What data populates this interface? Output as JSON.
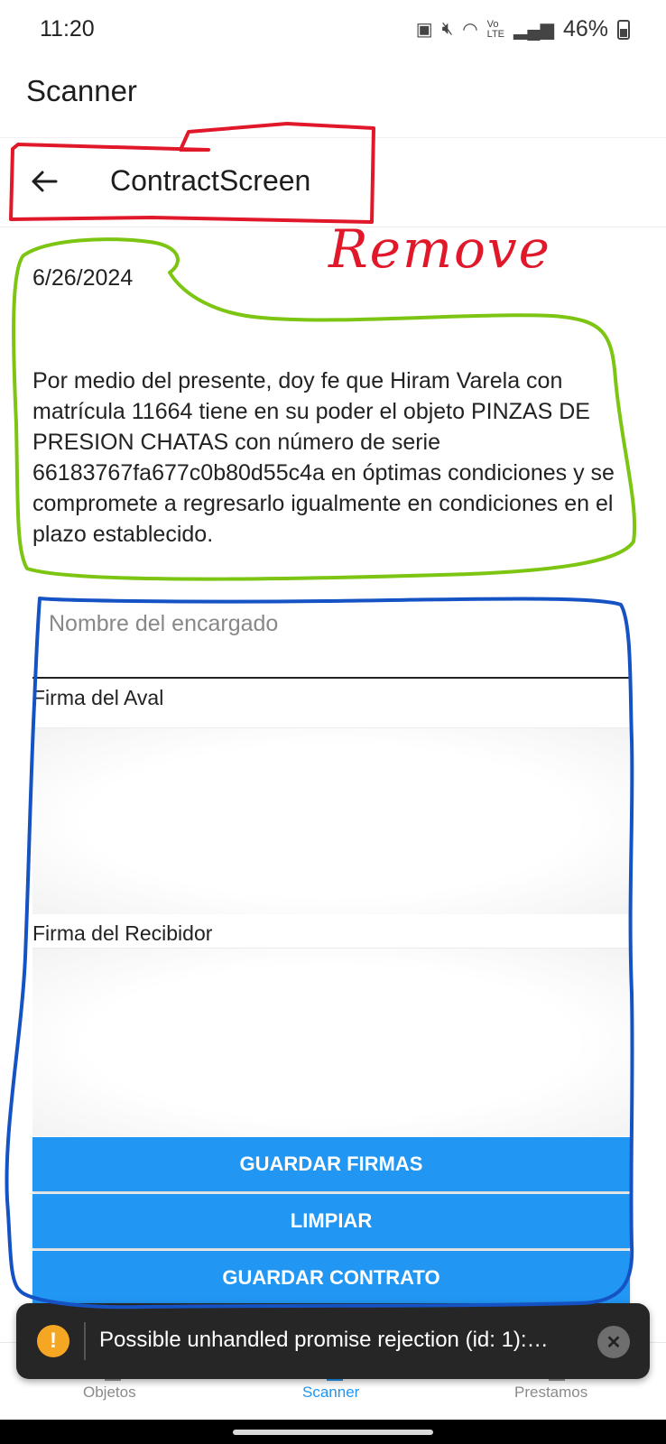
{
  "status_bar": {
    "time": "11:20",
    "battery": "46%",
    "icons": [
      "battery-saver-icon",
      "mute-icon",
      "wifi-icon",
      "volte-icon",
      "signal-icon",
      "battery-icon"
    ]
  },
  "app": {
    "title": "Scanner"
  },
  "header": {
    "title": "ContractScreen",
    "back_icon": "arrow-left-icon"
  },
  "contract": {
    "date": "6/26/2024",
    "text": "Por medio del presente, doy fe que Hiram Varela con matrícula 11664 tiene en su poder el objeto PINZAS DE PRESION CHATAS con número de serie 66183767fa677c0b80d55c4a en óptimas condiciones y se compromete a regresarlo igualmente en condiciones en el plazo establecido."
  },
  "form": {
    "name_placeholder": "Nombre del encargado",
    "name_value": "",
    "aval_label": "Firma del Aval",
    "receiver_label": "Firma del Recibidor"
  },
  "buttons": {
    "save_signatures": "GUARDAR FIRMAS",
    "clear": "LIMPIAR",
    "save_contract": "GUARDAR CONTRATO"
  },
  "toast": {
    "icon": "warning-icon",
    "message": "Possible unhandled promise rejection (id: 1):…",
    "dismiss_icon": "close-icon"
  },
  "tabs": [
    {
      "label": "Objetos",
      "active": false
    },
    {
      "label": "Scanner",
      "active": true
    },
    {
      "label": "Prestamos",
      "active": false
    }
  ],
  "annotations": {
    "remove_label": "Remove"
  },
  "colors": {
    "primary_button": "#2196F3",
    "active_tab": "#2196F3",
    "inactive_tab": "#8a8a8a",
    "annotation_red": "#e0182a",
    "annotation_green": "#7cc512",
    "annotation_blue": "#1552c4",
    "toast_bg": "#262626",
    "warning": "#F5A623"
  }
}
